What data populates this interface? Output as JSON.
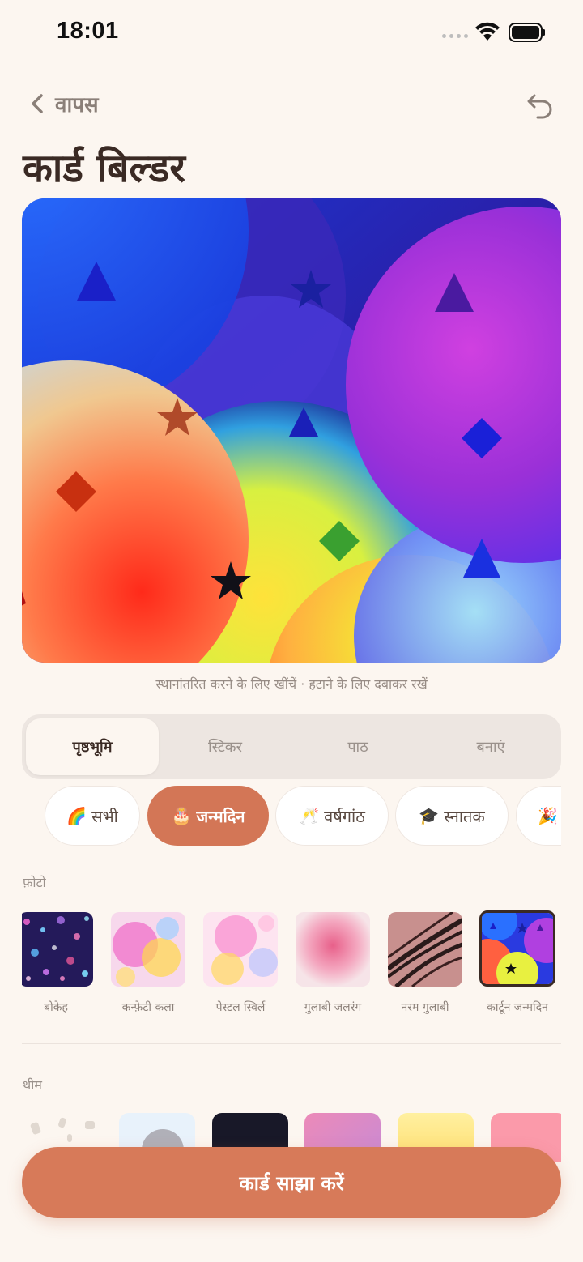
{
  "status_bar": {
    "time": "18:01"
  },
  "header": {
    "back_label": "वापस",
    "title": "कार्ड बिल्डर"
  },
  "canvas": {
    "hint": "स्थानांतरित करने के लिए खींचें · हटाने के लिए दबाकर रखें"
  },
  "tabs": [
    {
      "label": "पृष्ठभूमि",
      "active": true
    },
    {
      "label": "स्टिकर",
      "active": false
    },
    {
      "label": "पाठ",
      "active": false
    },
    {
      "label": "बनाएं",
      "active": false
    }
  ],
  "categories": [
    {
      "emoji": "🌈",
      "label": "सभी",
      "active": false
    },
    {
      "emoji": "🎂",
      "label": "जन्मदिन",
      "active": true
    },
    {
      "emoji": "🥂",
      "label": "वर्षगांठ",
      "active": false
    },
    {
      "emoji": "🎓",
      "label": "स्नातक",
      "active": false
    },
    {
      "emoji": "🎉",
      "label": "",
      "active": false
    }
  ],
  "photos_section": {
    "label": "फ़ोटो",
    "items": [
      {
        "label": "बोकेह",
        "selected": false
      },
      {
        "label": "कन्फ़ेटी कला",
        "selected": false
      },
      {
        "label": "पेस्टल स्विर्ल",
        "selected": false
      },
      {
        "label": "गुलाबी जलरंग",
        "selected": false
      },
      {
        "label": "नरम गुलाबी",
        "selected": false
      },
      {
        "label": "कार्टून जन्मदिन",
        "selected": true
      }
    ]
  },
  "themes_section": {
    "label": "थीम"
  },
  "share_button": {
    "label": "कार्ड साझा करें"
  },
  "colors": {
    "accent": "#d77a59",
    "background": "#fcf6f0",
    "text": "#3a2a24"
  }
}
